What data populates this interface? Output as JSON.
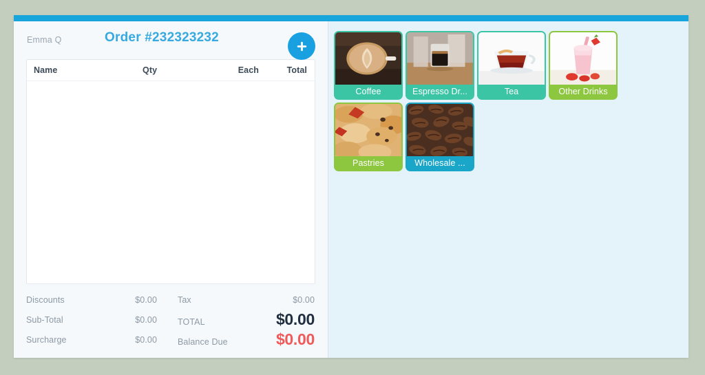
{
  "app": {
    "accent_blue": "#18a5dc",
    "page_background": "#c3cebf",
    "left_panel_background": "#f6f9fb",
    "right_panel_background": "#e4f2f9"
  },
  "order": {
    "cashier": "Emma Q",
    "title": "Order #232323232",
    "add_button_icon": "plus-icon",
    "columns": {
      "name": "Name",
      "qty": "Qty",
      "each": "Each",
      "total": "Total"
    },
    "items": [],
    "totals": {
      "rows": [
        {
          "left_label": "Discounts",
          "left_value": "$0.00",
          "right_label": "Tax",
          "right_value": "$0.00",
          "right_emphasis": "none"
        },
        {
          "left_label": "Sub-Total",
          "left_value": "$0.00",
          "right_label": "TOTAL",
          "right_value": "$0.00",
          "right_emphasis": "big"
        },
        {
          "left_label": "Surcharge",
          "left_value": "$0.00",
          "right_label": "Balance Due",
          "right_value": "$0.00",
          "right_emphasis": "big-danger"
        }
      ]
    }
  },
  "catalog": {
    "categories": [
      {
        "label": "Coffee",
        "icon": "latte-cup-icon",
        "color": "#3cc5a5",
        "variant": "tile-teal"
      },
      {
        "label": "Espresso Dr...",
        "icon": "espresso-shot-icon",
        "color": "#3cc5a5",
        "variant": "tile-teal"
      },
      {
        "label": "Tea",
        "icon": "tea-cup-icon",
        "color": "#3cc5a5",
        "variant": "tile-teal"
      },
      {
        "label": "Other Drinks",
        "icon": "milkshake-icon",
        "color": "#8dc63f",
        "variant": "tile-green"
      },
      {
        "label": "Pastries",
        "icon": "pastries-icon",
        "color": "#8dc63f",
        "variant": "tile-green"
      },
      {
        "label": "Wholesale ...",
        "icon": "coffee-beans-icon",
        "color": "#19a6c8",
        "variant": "tile-blue"
      }
    ]
  }
}
